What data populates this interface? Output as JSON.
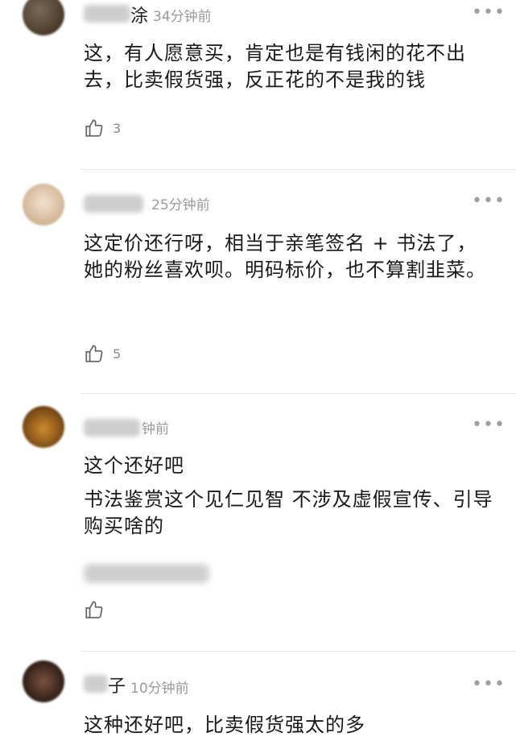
{
  "comments": [
    {
      "name_visible": "涂",
      "time": "34分钟前",
      "text": "这，有人愿意买，肯定也是有钱闲的花不出去，比卖假货强，反正花的不是我的钱",
      "likes": "3",
      "avatar_color": "#5a4a3a"
    },
    {
      "name_visible": "",
      "time": "25分钟前",
      "text": "这定价还行呀，相当于亲笔签名 + 书法了，她的粉丝喜欢呗。明码标价，也不算割韭菜。",
      "likes": "5",
      "avatar_color": "#d9c2a8"
    },
    {
      "name_visible": "",
      "time": "钟前",
      "text_line1": "这个还好吧",
      "text_line2": "书法鉴赏这个见仁见智 不涉及虚假宣传、引导购买啥的",
      "likes": "",
      "avatar_color": "#8a5a20"
    },
    {
      "name_visible": "子",
      "time": "10分钟前",
      "text_partial": "这种还好吧，比卖假货强太的多",
      "avatar_color": "#3a2a20"
    }
  ],
  "icons": {
    "like": "thumbs-up-icon",
    "more": "more-dots-icon"
  }
}
